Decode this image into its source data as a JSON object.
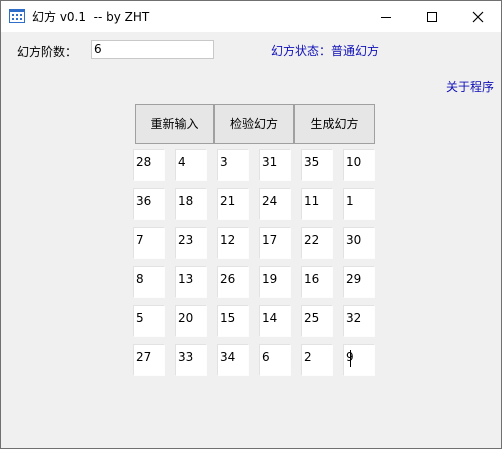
{
  "window": {
    "title": "幻方 v0.1  -- by ZHT"
  },
  "form": {
    "order_label": "幻方阶数：",
    "order_value": "6",
    "status_text": "幻方状态：普通幻方",
    "about_link": "关于程序"
  },
  "buttons": {
    "reset": "重新输入",
    "verify": "检验幻方",
    "generate": "生成幻方"
  },
  "grid": [
    [
      "28",
      "4",
      "3",
      "31",
      "35",
      "10"
    ],
    [
      "36",
      "18",
      "21",
      "24",
      "11",
      "1"
    ],
    [
      "7",
      "23",
      "12",
      "17",
      "22",
      "30"
    ],
    [
      "8",
      "13",
      "26",
      "19",
      "16",
      "29"
    ],
    [
      "5",
      "20",
      "15",
      "14",
      "25",
      "32"
    ],
    [
      "27",
      "33",
      "34",
      "6",
      "2",
      "9"
    ]
  ],
  "colors": {
    "link": "#1010b8",
    "icon": "#2f6fc9"
  }
}
